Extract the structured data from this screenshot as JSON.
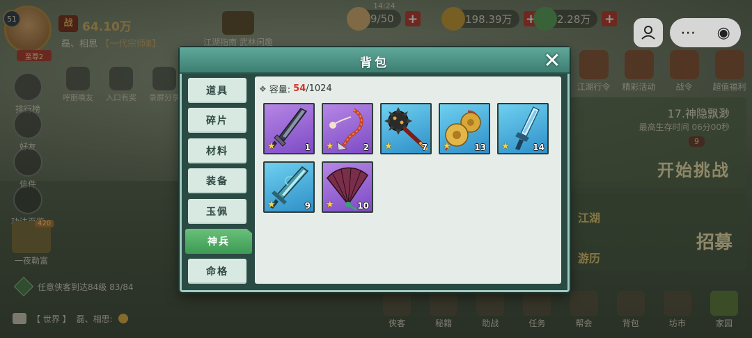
{
  "hud": {
    "level": "51",
    "rank": "至尊2",
    "power_icon": "战",
    "power": "64.10万",
    "player_name": "磊、相思",
    "player_title": "【一代宗师Ⅲ】",
    "clock": "14:24",
    "resources": [
      {
        "name": "stamina",
        "value": "9/50",
        "color": "#d8b070"
      },
      {
        "name": "copper",
        "value": "198.39万",
        "color": "#c89a30"
      },
      {
        "name": "jade",
        "value": "2.28万",
        "color": "#5aa05a"
      }
    ],
    "guide_label": "江湖指南 武林闲趣",
    "left_menu": [
      "排行榜",
      "好友",
      "信件",
      "功法百鉴"
    ],
    "mid_icons": [
      "呼朋唤友",
      "入口有奖",
      "录屏分享"
    ],
    "right_icons": [
      "江湖行令",
      "精彩活动",
      "战令",
      "超值福利"
    ],
    "challenge": {
      "name": "17.神隐飘渺",
      "sub": "最高生存时间  06分00秒",
      "badge": "9",
      "button": "开始挑战"
    },
    "recruit": {
      "a": "江湖",
      "b": "游历",
      "c": "招募"
    },
    "left_lower": {
      "label": "一夜勒富",
      "tag": "420"
    },
    "quest": "任意侠客到达84级 83/84",
    "chat": {
      "channel": "【 世界 】",
      "message": "磊、相思:"
    },
    "bottom_nav": [
      "侠客",
      "秘籍",
      "助战",
      "任务",
      "帮会",
      "背包",
      "坊市",
      "家园"
    ]
  },
  "modal": {
    "title": "背包",
    "close_glyph": "✕",
    "tabs": [
      "道具",
      "碎片",
      "材料",
      "装备",
      "玉佩",
      "神兵",
      "命格"
    ],
    "active_tab": "神兵",
    "capacity_label": "容量:",
    "capacity_used": "54",
    "capacity_total": "/1024",
    "items": [
      {
        "count": "1",
        "quality": "purple",
        "icon": "greatsword-icon"
      },
      {
        "count": "2",
        "quality": "purple",
        "icon": "rope-dart-icon"
      },
      {
        "count": "7",
        "quality": "blue",
        "icon": "meteor-hammer-icon"
      },
      {
        "count": "13",
        "quality": "blue",
        "icon": "cymbals-icon"
      },
      {
        "count": "14",
        "quality": "blue",
        "icon": "crystal-blade-icon"
      },
      {
        "count": "9",
        "quality": "blue",
        "icon": "jade-sword-icon"
      },
      {
        "count": "10",
        "quality": "purple",
        "icon": "iron-fan-icon"
      }
    ]
  },
  "colors": {
    "accent": "#3c9a52",
    "frame": "#2a4a44",
    "capacity_used": "#d6342c",
    "star": "#ffd43a"
  }
}
